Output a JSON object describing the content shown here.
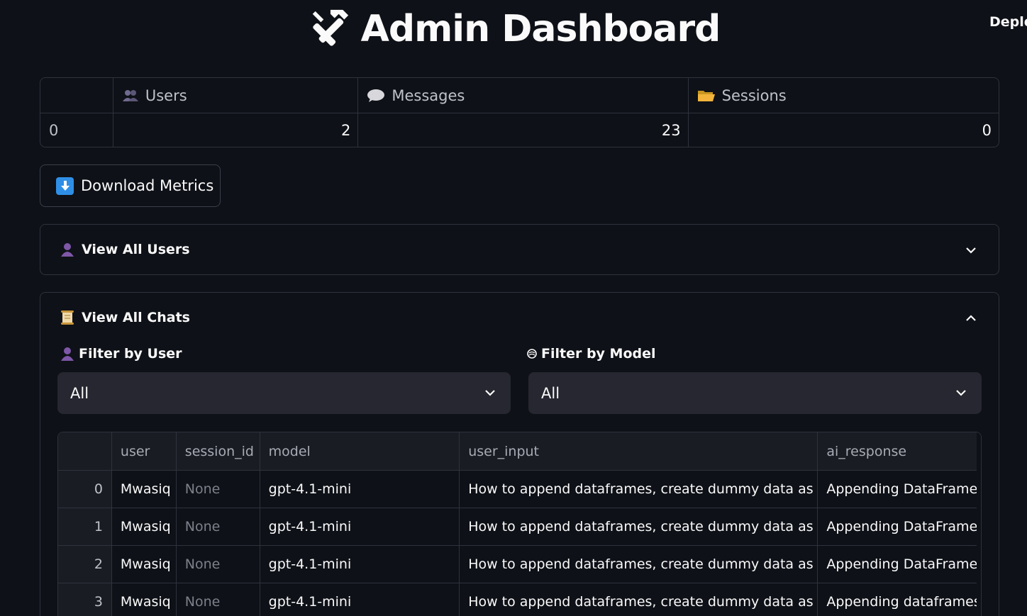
{
  "header": {
    "title": "Admin Dashboard",
    "deploy_label": "Deplo"
  },
  "metrics": {
    "columns": [
      "Users",
      "Messages",
      "Sessions"
    ],
    "row": {
      "index": "0",
      "users": "2",
      "messages": "23",
      "sessions": "0"
    }
  },
  "download_button": {
    "label": "Download Metrics"
  },
  "users_expander": {
    "label": "View All Users"
  },
  "chats_expander": {
    "label": "View All Chats",
    "filter_user": {
      "label": "Filter by User",
      "value": "All"
    },
    "filter_model": {
      "label": "Filter by Model",
      "value": "All"
    }
  },
  "table": {
    "columns": [
      "user",
      "session_id",
      "model",
      "user_input",
      "ai_response"
    ],
    "rows": [
      {
        "index": "0",
        "user": "Mwasiq",
        "session_id": "None",
        "model": "gpt-4.1-mini",
        "user_input": "How to append dataframes, create dummy data as well",
        "ai_response": "Appending DataFrames i"
      },
      {
        "index": "1",
        "user": "Mwasiq",
        "session_id": "None",
        "model": "gpt-4.1-mini",
        "user_input": "How to append dataframes, create dummy data as well",
        "ai_response": "Appending DataFrames i"
      },
      {
        "index": "2",
        "user": "Mwasiq",
        "session_id": "None",
        "model": "gpt-4.1-mini",
        "user_input": "How to append dataframes, create dummy data as well",
        "ai_response": "Appending DataFrames i"
      },
      {
        "index": "3",
        "user": "Mwasiq",
        "session_id": "None",
        "model": "gpt-4.1-mini",
        "user_input": "How to append dataframes, create dummy data as well",
        "ai_response": "Appending dataframes i"
      }
    ]
  },
  "colors": {
    "background": "#0e1117",
    "panel": "#262730",
    "border": "#2f323b",
    "download_icon": "#2f8fe6"
  }
}
